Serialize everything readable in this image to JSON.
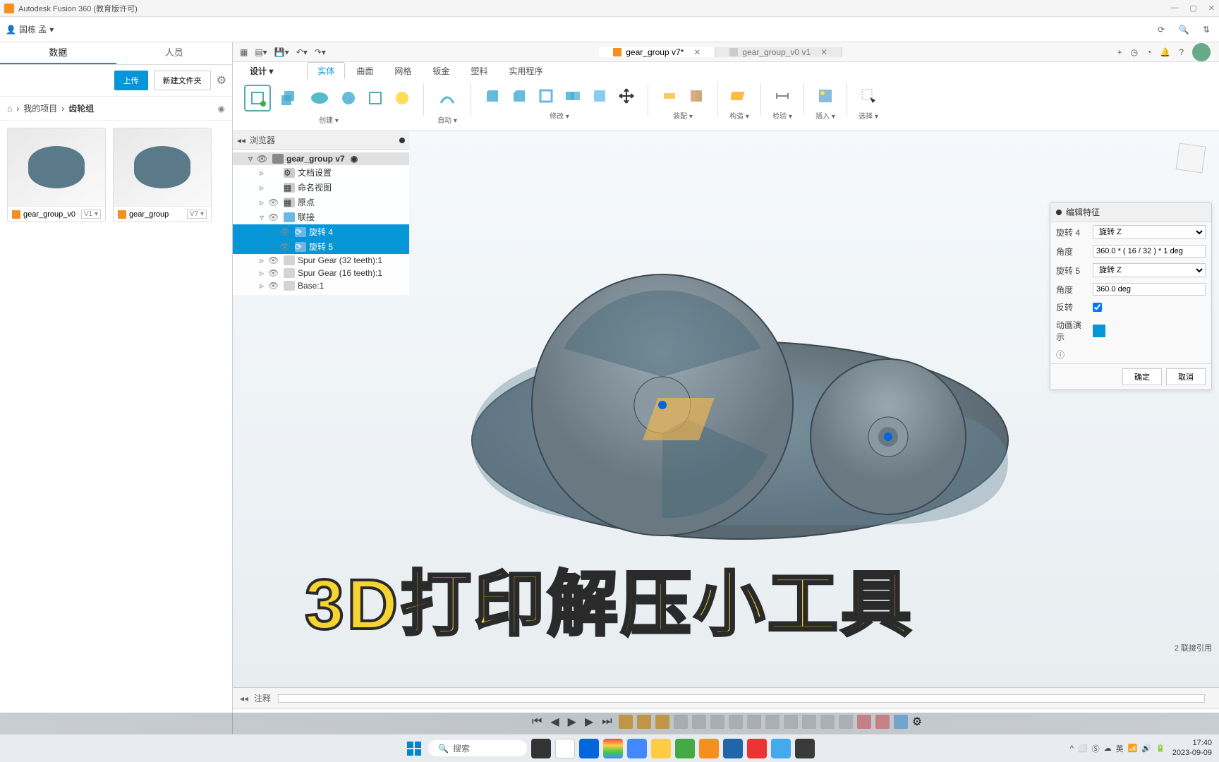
{
  "titlebar": {
    "title": "Autodesk Fusion 360 (教育版许可)"
  },
  "topbar": {
    "username": "国栋 孟"
  },
  "left": {
    "tabs": {
      "data": "数据",
      "people": "人员"
    },
    "upload": "上传",
    "newfolder": "新建文件夹",
    "breadcrumb": {
      "myproject": "我的项目",
      "current": "齿轮组"
    },
    "thumbs": [
      {
        "name": "gear_group_v0",
        "ver": "V1 ▾"
      },
      {
        "name": "gear_group",
        "ver": "V7 ▾"
      }
    ]
  },
  "doctabs": {
    "active": "gear_group v7*",
    "inactive": "gear_group_v0 v1"
  },
  "ribbon": {
    "design": "设计 ▾",
    "tabs": [
      "实体",
      "曲面",
      "网格",
      "钣金",
      "塑料",
      "实用程序"
    ],
    "groups": {
      "create": "创建 ▾",
      "auto": "自动 ▾",
      "modify": "修改 ▾",
      "assemble": "装配 ▾",
      "construct": "构造 ▾",
      "inspect": "检验 ▾",
      "insert": "插入 ▾",
      "select": "选择 ▾"
    }
  },
  "browser": {
    "title": "浏览器",
    "root": "gear_group v7",
    "items": {
      "docsettings": "文档设置",
      "namedviews": "命名视图",
      "origin": "原点",
      "joints": "联接",
      "rot4": "旋转 4",
      "rot5": "旋转 5",
      "spur32": "Spur Gear (32 teeth):1",
      "spur16": "Spur Gear (16 teeth):1",
      "base": "Base:1"
    }
  },
  "editpanel": {
    "title": "编辑特征",
    "rot4_label": "旋转 4",
    "rot4_value": "旋转 Z",
    "angle_label": "角度",
    "angle1_value": "360.0 * ( 16 / 32 ) * 1 deg",
    "rot5_label": "旋转 5",
    "rot5_value": "旋转 Z",
    "angle2_value": "360.0 deg",
    "reverse": "反转",
    "demo": "动画演示",
    "ok": "确定",
    "cancel": "取消"
  },
  "timeline": {
    "comment": "注释"
  },
  "status": {
    "refs": "2 联接引用"
  },
  "overlay": "3D打印解压小工具",
  "taskbar": {
    "search": "搜索",
    "time": "17:40",
    "date": "2023-09-09"
  }
}
